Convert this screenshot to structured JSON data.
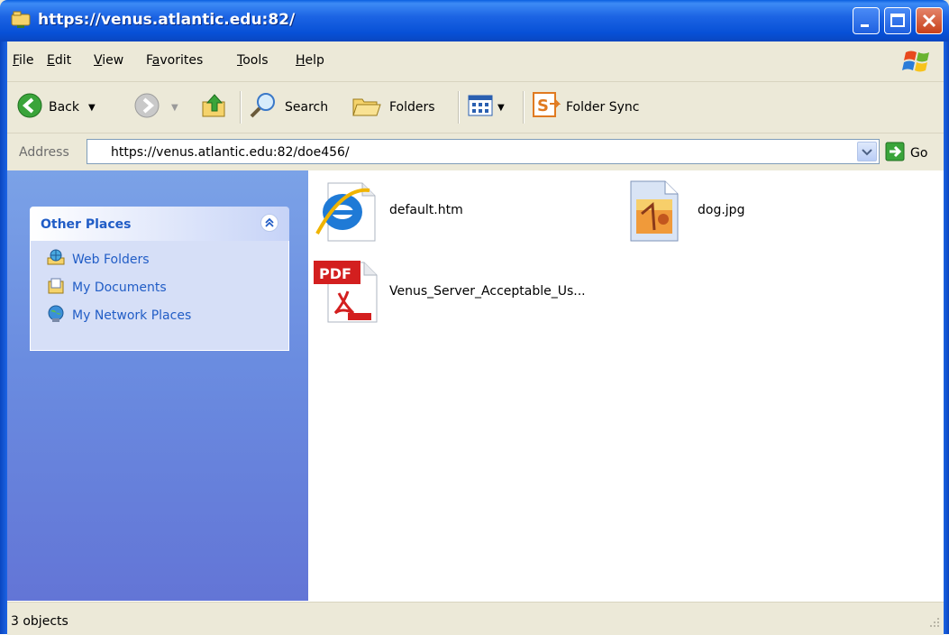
{
  "window": {
    "title": "https://venus.atlantic.edu:82/"
  },
  "menu": {
    "items": [
      {
        "label": "File",
        "key": "F",
        "rest": "ile"
      },
      {
        "label": "Edit",
        "key": "E",
        "rest": "dit"
      },
      {
        "label": "View",
        "key": "V",
        "rest": "iew"
      },
      {
        "label": "Favorites",
        "pre": "F",
        "key": "a",
        "rest": "vorites"
      },
      {
        "label": "Tools",
        "key": "T",
        "rest": "ools"
      },
      {
        "label": "Help",
        "key": "H",
        "rest": "elp"
      }
    ]
  },
  "toolbar": {
    "back_label": "Back",
    "search_label": "Search",
    "folders_label": "Folders",
    "folder_sync_label": "Folder Sync"
  },
  "address": {
    "label": "Address",
    "value": "https://venus.atlantic.edu:82/doe456/",
    "go_label": "Go"
  },
  "sidebar": {
    "panel_title": "Other Places",
    "places": [
      {
        "label": "Web Folders",
        "icon": "web-folders-icon"
      },
      {
        "label": "My Documents",
        "icon": "my-documents-icon"
      },
      {
        "label": "My Network Places",
        "icon": "network-places-icon"
      }
    ]
  },
  "files": [
    {
      "name": "default.htm",
      "icon": "internet-explorer-icon"
    },
    {
      "name": "dog.jpg",
      "icon": "image-file-icon"
    },
    {
      "name": "Venus_Server_Acceptable_Us...",
      "icon": "pdf-file-icon"
    }
  ],
  "status": {
    "text": "3 objects"
  },
  "colors": {
    "titlebar": "#0a5fe0",
    "sidebar_link": "#215dc6",
    "sidebar_bg": "#6a8ce0"
  }
}
